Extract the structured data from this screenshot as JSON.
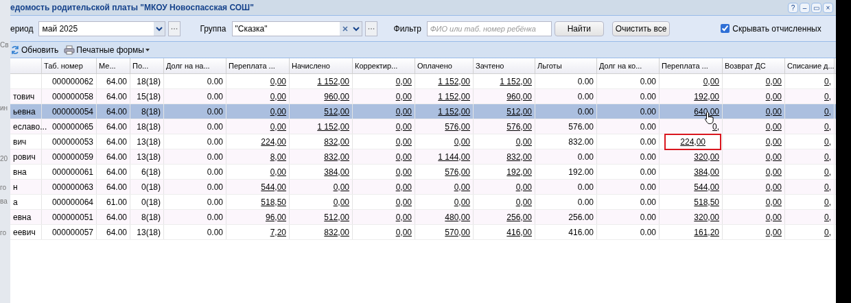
{
  "backdrop": {
    "fragments": [
      "Св",
      "ин",
      "20",
      "го",
      "ва",
      "го"
    ]
  },
  "window": {
    "title": "едомость родительской платы \"МКОУ Новоспасская СОШ\"",
    "controls": [
      "?",
      "–",
      "▭",
      "×"
    ]
  },
  "filters": {
    "period_label": "ериод",
    "period_value": "май 2025",
    "group_label": "Группа",
    "group_value": "\"Сказка\"",
    "filter_label": "Фильтр",
    "filter_placeholder": "ФИО или таб. номер ребёнка",
    "find_button": "Найти",
    "clear_button": "Очистить все",
    "hide_expelled": {
      "label": "Скрывать отчисленных",
      "checked": true
    }
  },
  "toolbar": {
    "refresh": "Обновить",
    "print_forms": "Печатные формы"
  },
  "table": {
    "columns": [
      {
        "link": false,
        "annotation_target": false
      },
      {
        "label": "Таб. номер",
        "link": false,
        "annotation_target": false
      },
      {
        "label": "Ме...",
        "link": false,
        "annotation_target": false
      },
      {
        "label": "По...",
        "link": false,
        "annotation_target": false
      },
      {
        "label": "Долг на на...",
        "link": false,
        "annotation_target": false
      },
      {
        "label": "Переплата ...",
        "link": true,
        "annotation_target": false
      },
      {
        "label": "Начислено",
        "link": true,
        "annotation_target": false
      },
      {
        "label": "Корректир...",
        "link": true,
        "annotation_target": false
      },
      {
        "label": "Оплачено",
        "link": true,
        "annotation_target": false
      },
      {
        "label": "Зачтено",
        "link": true,
        "annotation_target": false
      },
      {
        "label": "Льготы",
        "link": false,
        "annotation_target": false
      },
      {
        "label": "Долг на ко...",
        "link": false,
        "annotation_target": false
      },
      {
        "label": "Переплата ...",
        "link": true,
        "annotation_target": true
      },
      {
        "label": "Возврат ДС",
        "link": true,
        "annotation_target": false
      },
      {
        "label": "Списание д...",
        "link": true,
        "annotation_target": false
      }
    ],
    "rows": [
      {
        "selected": false,
        "annotated": false,
        "pointer": false,
        "cells": [
          "",
          "000000062",
          "64.00",
          "18(18)",
          "0.00",
          "0,00",
          "1 152,00",
          "0,00",
          "1 152,00",
          "1 152,00",
          "0.00",
          "0.00",
          "0,00",
          "0,00",
          "0,"
        ]
      },
      {
        "selected": false,
        "annotated": false,
        "pointer": false,
        "cells": [
          "тович",
          "000000058",
          "64.00",
          "15(18)",
          "0.00",
          "0,00",
          "960,00",
          "0,00",
          "1 152,00",
          "960,00",
          "0.00",
          "0.00",
          "192,00",
          "0,00",
          "0,"
        ]
      },
      {
        "selected": true,
        "annotated": false,
        "pointer": true,
        "cells": [
          "ьевна",
          "000000054",
          "64.00",
          "8(18)",
          "0.00",
          "0,00",
          "512,00",
          "0,00",
          "1 152,00",
          "512,00",
          "0.00",
          "0.00",
          "640,00",
          "0,00",
          "0,"
        ]
      },
      {
        "selected": false,
        "annotated": false,
        "pointer": false,
        "cells": [
          "еславо...",
          "000000065",
          "64.00",
          "18(18)",
          "0.00",
          "0,00",
          "1 152,00",
          "0,00",
          "576,00",
          "576,00",
          "576.00",
          "0.00",
          "0,",
          "0,00",
          "0,"
        ]
      },
      {
        "selected": false,
        "annotated": true,
        "pointer": false,
        "cells": [
          "вич",
          "000000053",
          "64.00",
          "13(18)",
          "0.00",
          "224,00",
          "832,00",
          "0,00",
          "0,00",
          "0,00",
          "832.00",
          "0.00",
          "224,00",
          "0,00",
          "0,"
        ]
      },
      {
        "selected": false,
        "annotated": false,
        "pointer": false,
        "cells": [
          "рович",
          "000000059",
          "64.00",
          "13(18)",
          "0.00",
          "8,00",
          "832,00",
          "0,00",
          "1 144,00",
          "832,00",
          "0.00",
          "0.00",
          "320,00",
          "0,00",
          "0,"
        ]
      },
      {
        "selected": false,
        "annotated": false,
        "pointer": false,
        "cells": [
          "вна",
          "000000061",
          "64.00",
          "6(18)",
          "0.00",
          "0,00",
          "384,00",
          "0,00",
          "576,00",
          "192,00",
          "192.00",
          "0.00",
          "384,00",
          "0,00",
          "0,"
        ]
      },
      {
        "selected": false,
        "annotated": false,
        "pointer": false,
        "cells": [
          "н",
          "000000063",
          "64.00",
          "0(18)",
          "0.00",
          "544,00",
          "0,00",
          "0,00",
          "0,00",
          "0,00",
          "0.00",
          "0.00",
          "544,00",
          "0,00",
          "0,"
        ]
      },
      {
        "selected": false,
        "annotated": false,
        "pointer": false,
        "cells": [
          "а",
          "000000064",
          "61.00",
          "0(18)",
          "0.00",
          "518,50",
          "0,00",
          "0,00",
          "0,00",
          "0,00",
          "0.00",
          "0.00",
          "518,50",
          "0,00",
          "0,"
        ]
      },
      {
        "selected": false,
        "annotated": false,
        "pointer": false,
        "cells": [
          "евна",
          "000000051",
          "64.00",
          "8(18)",
          "0.00",
          "96,00",
          "512,00",
          "0,00",
          "480,00",
          "256,00",
          "256.00",
          "0.00",
          "320,00",
          "0,00",
          "0,"
        ]
      },
      {
        "selected": false,
        "annotated": false,
        "pointer": false,
        "cells": [
          "еевич",
          "000000057",
          "64.00",
          "13(18)",
          "0.00",
          "7,20",
          "832,00",
          "0,00",
          "570,00",
          "416,00",
          "416.00",
          "0.00",
          "161,20",
          "0,00",
          "0,"
        ]
      }
    ]
  }
}
